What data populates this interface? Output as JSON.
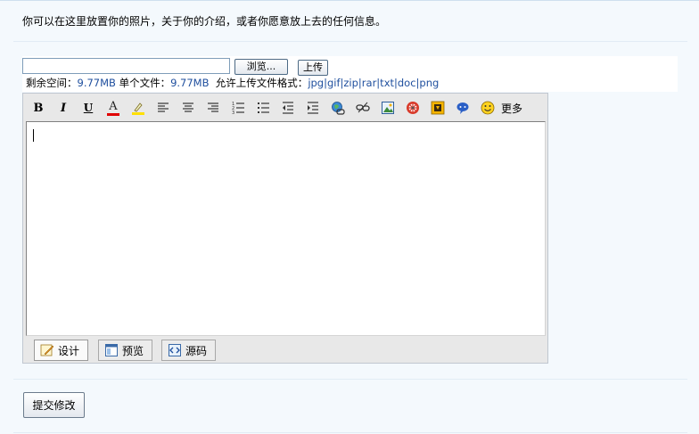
{
  "intro_text": "你可以在这里放置你的照片，关于你的介绍，或者你愿意放上去的任何信息。",
  "upload": {
    "file_value": "",
    "browse_label": "浏览...",
    "upload_label": "上传",
    "remain_label": "剩余空间：",
    "remain_value": "9.77MB",
    "single_label": " 单个文件：",
    "single_value": "9.77MB",
    "formats_label": "  允许上传文件格式：",
    "formats_value": "jpg|gif|zip|rar|txt|doc|png"
  },
  "toolbar": {
    "bold": "B",
    "italic": "I",
    "underline": "U",
    "font_color": "A",
    "more_label": "更多"
  },
  "modes": {
    "design": "设计",
    "preview": "预览",
    "source": "源码"
  },
  "submit_label": "提交修改",
  "colors": {
    "link": "#1f4f9e",
    "background": "#f4f9fd",
    "font_color_bar": "#e00000",
    "highlight_bar": "#ffe000"
  }
}
